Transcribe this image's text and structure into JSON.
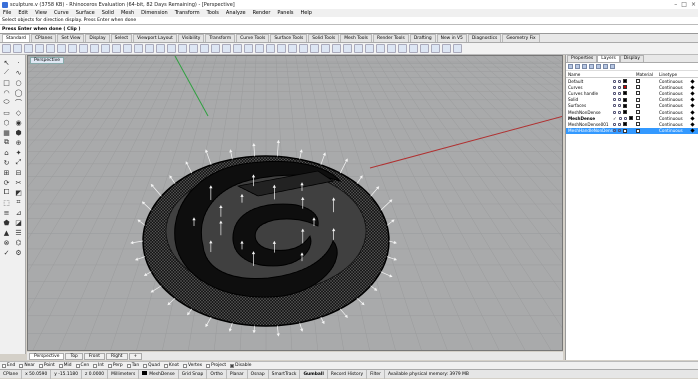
{
  "window": {
    "title": "sculpture.v (3758 KB) - Rhinoceros Evaluation (64-bit, 82 Days Remaining) - [Perspective]",
    "controls": [
      "–",
      "□",
      "×"
    ]
  },
  "menu": [
    "File",
    "Edit",
    "View",
    "Curve",
    "Surface",
    "Solid",
    "Mesh",
    "Dimension",
    "Transform",
    "Tools",
    "Analyze",
    "Render",
    "Panels",
    "Help"
  ],
  "command": {
    "history": "Select objects for direction display. Press Enter when done",
    "prompt": "Press Enter when done ( Clip )"
  },
  "toolbar_tabs": [
    "Standard",
    "CPlanes",
    "Set View",
    "Display",
    "Select",
    "Viewport Layout",
    "Visibility",
    "Transform",
    "Curve Tools",
    "Surface Tools",
    "Solid Tools",
    "Mesh Tools",
    "Render Tools",
    "Drafting",
    "New in V5",
    "Diagnostics",
    "Geometry Fix"
  ],
  "active_toolbar_tab": "Standard",
  "viewport": {
    "label": "Perspective"
  },
  "viewport_tabs": [
    "Perspective",
    "Top",
    "Front",
    "Right"
  ],
  "active_viewport_tab": "Perspective",
  "osnaps": [
    {
      "label": "End",
      "on": false
    },
    {
      "label": "Near",
      "on": false
    },
    {
      "label": "Point",
      "on": false
    },
    {
      "label": "Mid",
      "on": false
    },
    {
      "label": "Cen",
      "on": false
    },
    {
      "label": "Int",
      "on": false
    },
    {
      "label": "Perp",
      "on": false
    },
    {
      "label": "Tan",
      "on": false
    },
    {
      "label": "Quad",
      "on": false
    },
    {
      "label": "Knot",
      "on": false
    },
    {
      "label": "Vertex",
      "on": false
    },
    {
      "label": "Project",
      "on": false
    },
    {
      "label": "Disable",
      "on": true
    }
  ],
  "status": {
    "cplane": "CPlane",
    "x": "x 50.0590",
    "y": "y -15.1180",
    "z": "z 0.0000",
    "units": "Millimeters",
    "layer": "MeshDense",
    "grid_snap": "Grid Snap",
    "ortho": "Ortho",
    "planar": "Planar",
    "osnap": "Osnap",
    "smarttrack": "SmartTrack",
    "gumball": "Gumball",
    "record_history": "Record History",
    "filter": "Filter",
    "memory": "Available physical memory: 3979 MB"
  },
  "panel": {
    "tabs": [
      "Properties",
      "Layers",
      "Display"
    ],
    "active_tab": "Layers",
    "columns": [
      "Name",
      "Material",
      "Linetype"
    ],
    "layers": [
      {
        "name": "Default",
        "color": "#000000",
        "linetype": "Continuous",
        "current": false,
        "selected": false
      },
      {
        "name": "Curves",
        "color": "#cc0000",
        "linetype": "Continuous",
        "current": false,
        "selected": false
      },
      {
        "name": "Curves handle",
        "color": "#000000",
        "linetype": "Continuous",
        "current": false,
        "selected": false
      },
      {
        "name": "Solid",
        "color": "#000000",
        "linetype": "Continuous",
        "current": false,
        "selected": false
      },
      {
        "name": "Surfaces",
        "color": "#000000",
        "linetype": "Continuous",
        "current": false,
        "selected": false
      },
      {
        "name": "MeshNonDense",
        "color": "#000000",
        "linetype": "Continuous",
        "current": false,
        "selected": false
      },
      {
        "name": "MeshDense",
        "color": "#000000",
        "linetype": "Continuous",
        "current": true,
        "selected": false
      },
      {
        "name": "MeshNonDense001",
        "color": "#000000",
        "linetype": "Continuous",
        "current": false,
        "selected": false
      },
      {
        "name": "MeshHandleNonDense",
        "color": "#ffffff",
        "linetype": "Continuous",
        "current": false,
        "selected": true
      }
    ]
  },
  "colors": {
    "viewport_bg": "#a9aaab",
    "grid_line": "#9a9b9c",
    "x_axis": "#b03030",
    "y_axis": "#2fa040",
    "selection": "#3399ff"
  }
}
